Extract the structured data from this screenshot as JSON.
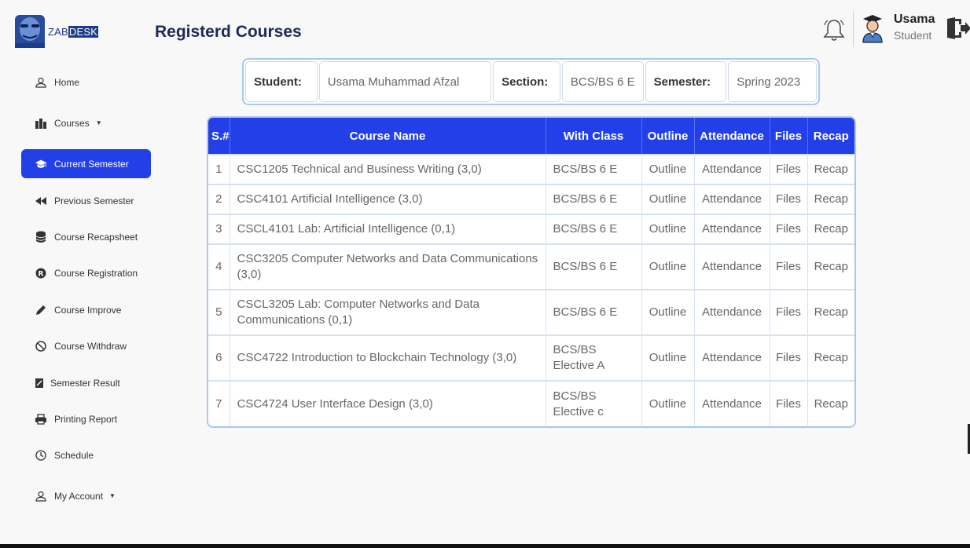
{
  "header": {
    "logo_plain": "ZAB",
    "logo_highlight": "DESK",
    "title": "Registerd Courses",
    "user_name": "Usama",
    "user_role": "Student"
  },
  "sidebar": {
    "items": [
      {
        "label": "Home",
        "icon": "user-icon"
      },
      {
        "label": "Courses",
        "icon": "books-icon"
      },
      {
        "label": "Current Semester",
        "icon": "graduation-cap-icon"
      },
      {
        "label": "Previous Semester",
        "icon": "backward-icon"
      },
      {
        "label": "Course Recapsheet",
        "icon": "database-icon"
      },
      {
        "label": "Course Registration",
        "icon": "registered-icon"
      },
      {
        "label": "Course Improve",
        "icon": "pencil-icon"
      },
      {
        "label": "Course Withdraw",
        "icon": "ban-icon"
      },
      {
        "label": "Semester Result",
        "icon": "report-icon"
      },
      {
        "label": "Printing Report",
        "icon": "printer-icon"
      },
      {
        "label": "Schedule",
        "icon": "clock-icon"
      },
      {
        "label": "My Account",
        "icon": "user-icon"
      }
    ],
    "active_index": 2
  },
  "info": {
    "student_label": "Student:",
    "student_value": "Usama Muhammad Afzal",
    "section_label": "Section:",
    "section_value": "BCS/BS 6 E",
    "semester_label": "Semester:",
    "semester_value": "Spring 2023"
  },
  "table": {
    "headers": [
      "S.#",
      "Course Name",
      "With Class",
      "Outline",
      "Attendance",
      "Files",
      "Recap"
    ],
    "rows": [
      {
        "sn": "1",
        "course": "CSC1205 Technical and Business Writing (3,0)",
        "class": "BCS/BS 6 E",
        "outline": "Outline",
        "attendance": "Attendance",
        "files": "Files",
        "recap": "Recap"
      },
      {
        "sn": "2",
        "course": "CSC4101 Artificial Intelligence (3,0)",
        "class": "BCS/BS 6 E",
        "outline": "Outline",
        "attendance": "Attendance",
        "files": "Files",
        "recap": "Recap"
      },
      {
        "sn": "3",
        "course": "CSCL4101 Lab: Artificial Intelligence (0,1)",
        "class": "BCS/BS 6 E",
        "outline": "Outline",
        "attendance": "Attendance",
        "files": "Files",
        "recap": "Recap"
      },
      {
        "sn": "4",
        "course": "CSC3205 Computer Networks and Data Communications (3,0)",
        "class": "BCS/BS 6 E",
        "outline": "Outline",
        "attendance": "Attendance",
        "files": "Files",
        "recap": "Recap"
      },
      {
        "sn": "5",
        "course": "CSCL3205 Lab: Computer Networks and Data Communications (0,1)",
        "class": "BCS/BS 6 E",
        "outline": "Outline",
        "attendance": "Attendance",
        "files": "Files",
        "recap": "Recap"
      },
      {
        "sn": "6",
        "course": "CSC4722 Introduction to Blockchain Technology (3,0)",
        "class": "BCS/BS Elective A",
        "outline": "Outline",
        "attendance": "Attendance",
        "files": "Files",
        "recap": "Recap"
      },
      {
        "sn": "7",
        "course": "CSC4724 User Interface Design (3,0)",
        "class": "BCS/BS Elective c",
        "outline": "Outline",
        "attendance": "Attendance",
        "files": "Files",
        "recap": "Recap"
      }
    ]
  },
  "colors": {
    "accent": "#2340e8",
    "border": "#a8c9ee",
    "title": "#1c2a55"
  }
}
